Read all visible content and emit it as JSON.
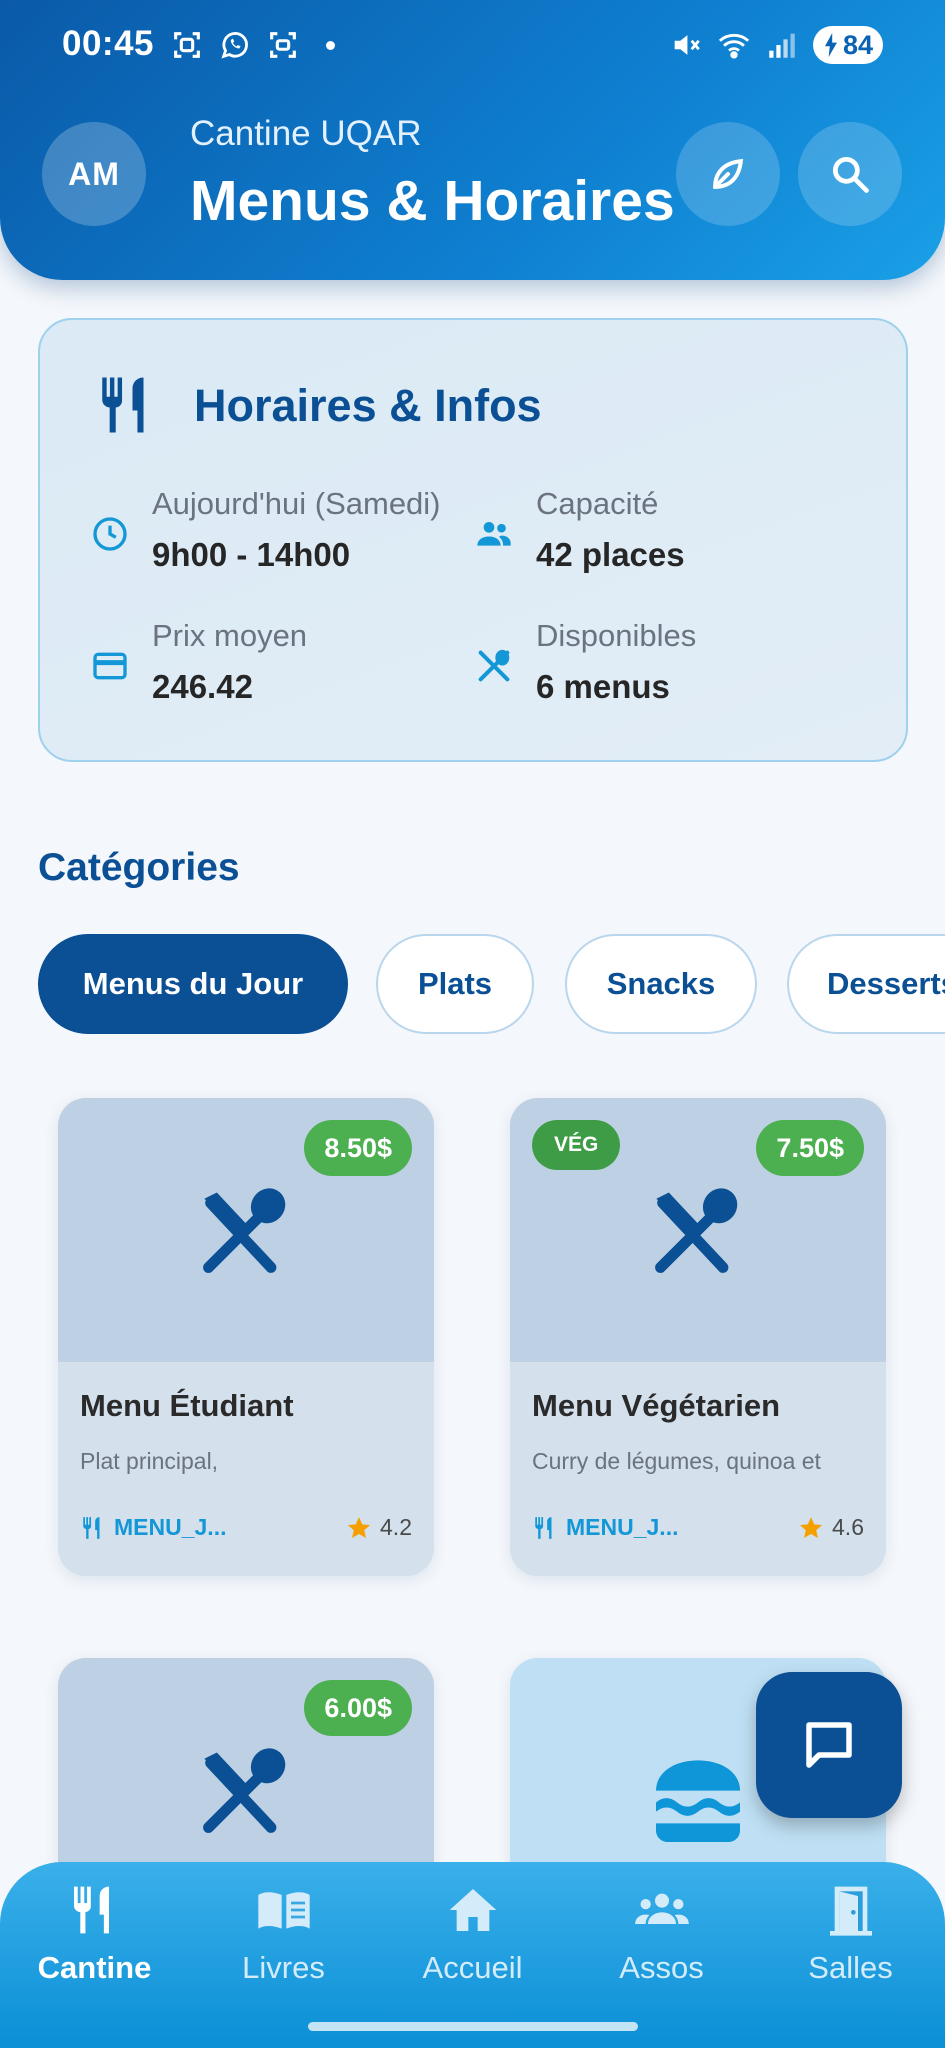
{
  "status_bar": {
    "time": "00:45",
    "battery": "84"
  },
  "header": {
    "avatar_initials": "AM",
    "subtitle": "Cantine UQAR",
    "title": "Menus & Horaires"
  },
  "info_card": {
    "title": "Horaires & Infos",
    "items": [
      {
        "label": "Aujourd'hui (Samedi)",
        "value": "9h00 - 14h00",
        "icon": "clock-icon"
      },
      {
        "label": "Capacité",
        "value": "42 places",
        "icon": "people-icon"
      },
      {
        "label": "Prix moyen",
        "value": "246.42",
        "icon": "credit-card-icon"
      },
      {
        "label": "Disponibles",
        "value": "6 menus",
        "icon": "utensils-icon"
      }
    ]
  },
  "categories": {
    "title": "Catégories",
    "chips": [
      {
        "label": "Menus du Jour",
        "active": true
      },
      {
        "label": "Plats",
        "active": false
      },
      {
        "label": "Snacks",
        "active": false
      },
      {
        "label": "Desserts",
        "active": false
      }
    ]
  },
  "menus": [
    {
      "name": "Menu Étudiant",
      "description": "Plat principal,",
      "price": "8.50$",
      "category": "MENU_J...",
      "rating": "4.2",
      "veg": false
    },
    {
      "name": "Menu Végétarien",
      "description": "Curry de légumes, quinoa et",
      "price": "7.50$",
      "category": "MENU_J...",
      "rating": "4.6",
      "veg": true,
      "veg_label": "VÉG"
    },
    {
      "price": "6.00$"
    },
    {}
  ],
  "bottom_nav": [
    {
      "label": "Cantine",
      "icon": "utensils-icon",
      "active": true
    },
    {
      "label": "Livres",
      "icon": "book-icon",
      "active": false
    },
    {
      "label": "Accueil",
      "icon": "home-icon",
      "active": false
    },
    {
      "label": "Assos",
      "icon": "groups-icon",
      "active": false
    },
    {
      "label": "Salles",
      "icon": "door-icon",
      "active": false
    }
  ],
  "colors": {
    "primary": "#0b4f94",
    "accent": "#1397d6",
    "price_green": "#4caf50",
    "star": "#f5a000"
  }
}
